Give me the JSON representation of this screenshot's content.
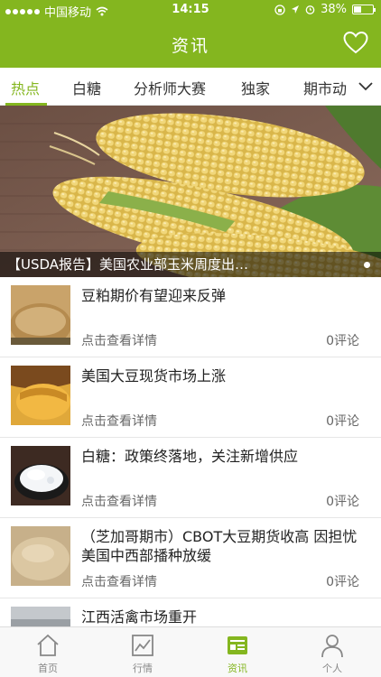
{
  "status_bar": {
    "carrier": "中国移动",
    "time": "14:15",
    "battery": "38%"
  },
  "header": {
    "title": "资讯",
    "favorite_icon": "heart-outline-icon"
  },
  "colors": {
    "accent": "#84b61f"
  },
  "tabs": [
    {
      "label": "热点",
      "active": true
    },
    {
      "label": "白糖",
      "active": false
    },
    {
      "label": "分析师大赛",
      "active": false
    },
    {
      "label": "独家",
      "active": false
    },
    {
      "label": "期市动",
      "active": false
    }
  ],
  "banner": {
    "caption": "【USDA报告】美国农业部玉米周度出…"
  },
  "news": [
    {
      "title": "豆粕期价有望迎来反弹",
      "more": "点击查看详情",
      "comments": "0评论",
      "thumb": "soymeal"
    },
    {
      "title": "美国大豆现货市场上涨",
      "more": "点击查看详情",
      "comments": "0评论",
      "thumb": "grain-scoop"
    },
    {
      "title": "白糖：政策终落地，关注新增供应",
      "more": "点击查看详情",
      "comments": "0评论",
      "thumb": "sugar"
    },
    {
      "title": "（芝加哥期市）CBOT大豆期货收高 因担忧美国中西部播种放缓",
      "more": "点击查看详情",
      "comments": "0评论",
      "thumb": "powder"
    },
    {
      "title": "江西活禽市场重开",
      "more": "",
      "comments": "",
      "thumb": "poultry"
    }
  ],
  "tabbar": [
    {
      "label": "首页",
      "icon": "home-icon",
      "active": false
    },
    {
      "label": "行情",
      "icon": "chart-icon",
      "active": false
    },
    {
      "label": "资讯",
      "icon": "news-icon",
      "active": true
    },
    {
      "label": "个人",
      "icon": "person-icon",
      "active": false
    }
  ]
}
